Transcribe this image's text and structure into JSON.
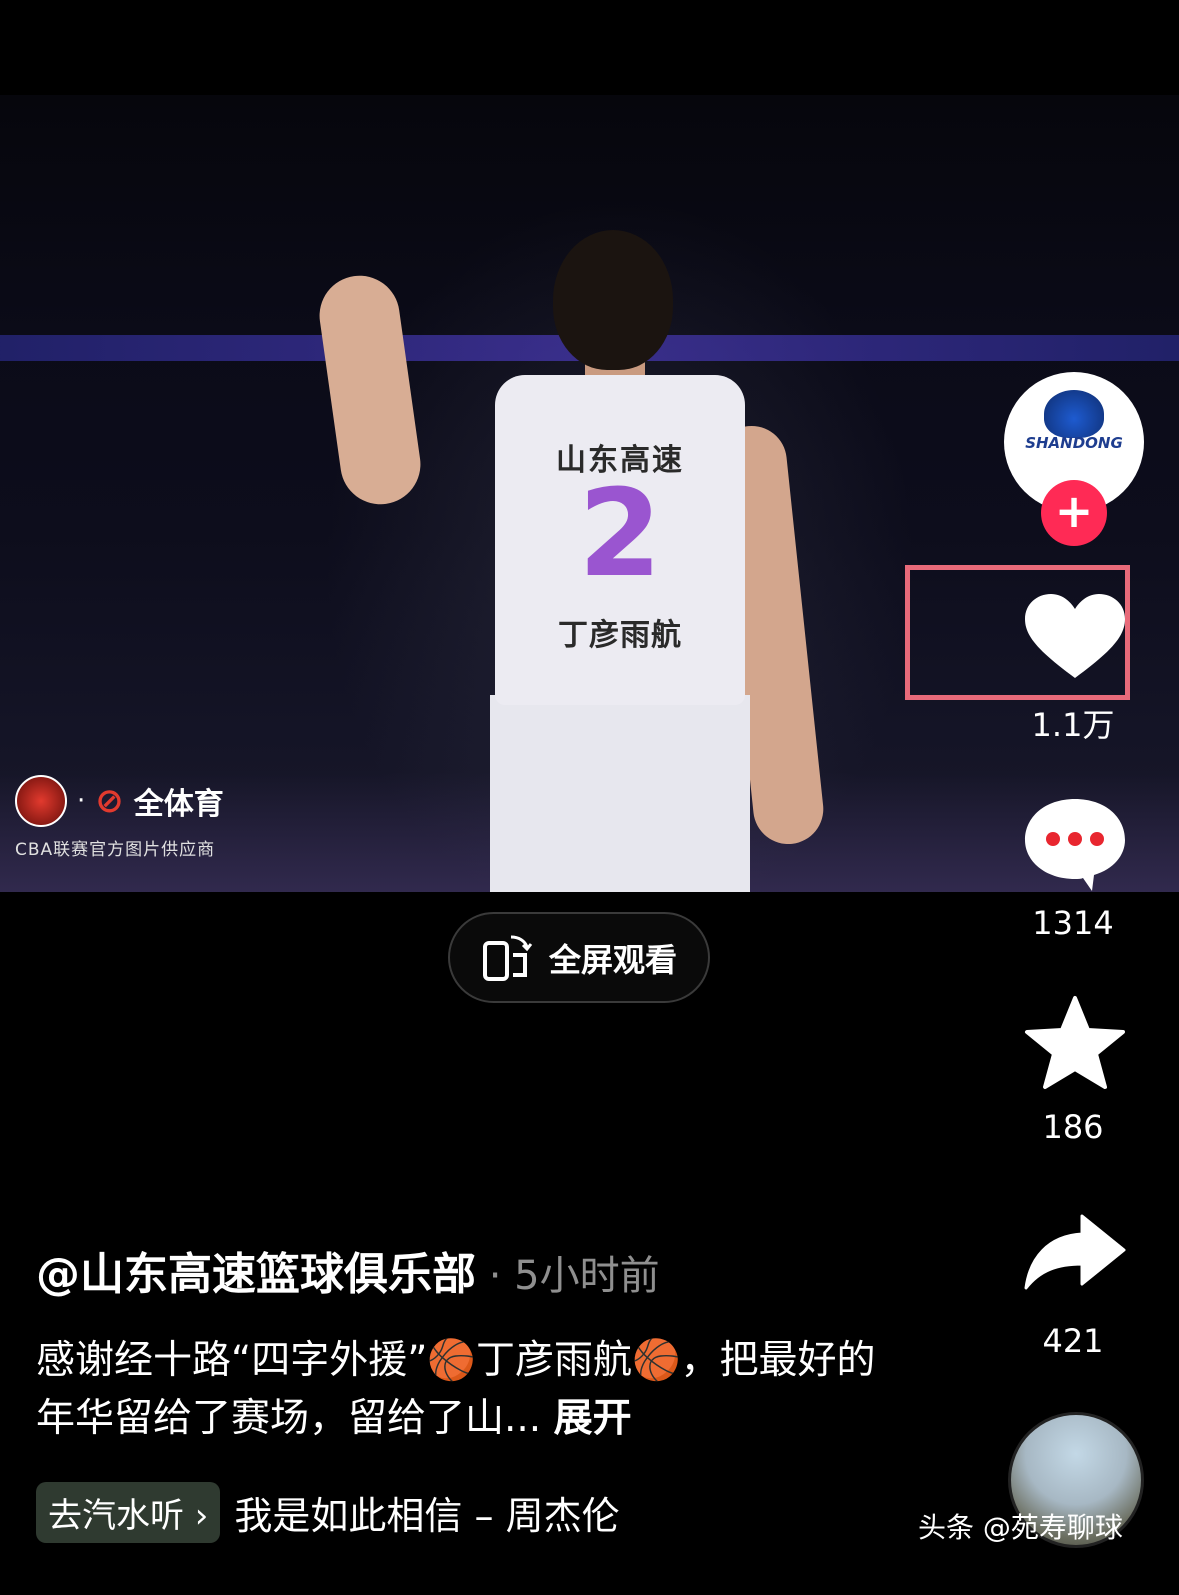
{
  "photo": {
    "jersey_team": "山东高速",
    "jersey_number": "2",
    "jersey_name": "丁彦雨航",
    "watermark_brand": "全体育",
    "watermark_supplier": "CBA联赛官方图片供应商"
  },
  "account_avatar": {
    "text": "SHANDONG"
  },
  "actions": {
    "like_count": "1.1万",
    "comment_count": "1314",
    "favorite_count": "186",
    "share_count": "421"
  },
  "fullscreen": {
    "label": "全屏观看"
  },
  "post": {
    "author": "@山东高速篮球俱乐部",
    "separator": " · ",
    "time": "5小时前",
    "desc_text": "感谢经十路“四字外援”🏀丁彦雨航🏀，把最好的年华留给了赛场，留给了山...",
    "expand_label": "展开"
  },
  "music": {
    "button_label": "去汽水听 ›",
    "title": "我是如此相信 – 周杰伦"
  },
  "source": {
    "text": "头条 @苑寿聊球"
  },
  "colors": {
    "follow": "#ff2a55",
    "background": "#000000"
  }
}
